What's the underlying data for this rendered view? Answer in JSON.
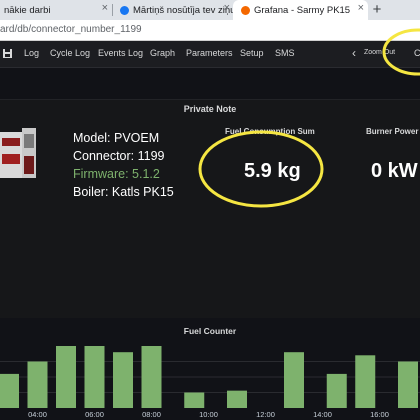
{
  "browser": {
    "tabs": [
      {
        "label": "nākie darbi",
        "favicon_color": "#9e2146"
      },
      {
        "label": "Mārtiņš nosūtīja tev ziņu",
        "favicon_color": "#1877f2"
      },
      {
        "label": "Grafana - Sarmy PK15",
        "favicon_color": "#f46800"
      }
    ],
    "new_tab_symbol": "+",
    "close_symbol": "×",
    "url": "ard/db/connector_number_1199"
  },
  "nav": {
    "save_icon": "save-icon",
    "items": [
      "Log",
      "Cycle Log",
      "Events Log",
      "Graph",
      "Parameters",
      "Setup",
      "SMS"
    ],
    "zoom_out": "Zoom Out",
    "prev_symbol": "‹",
    "clipped_text": "C"
  },
  "private_note": {
    "title": "Private Note"
  },
  "boiler_info": {
    "model": "Model: PVOEM",
    "connector": "Connector: 1199",
    "firmware": "Firmware: 5.1.2",
    "boiler": "Boiler: Katls PK15"
  },
  "stats": {
    "fuel_sum": {
      "title": "Fuel Consumption Sum",
      "value": "5.9 kg"
    },
    "burner_power": {
      "title": "Burner Power",
      "value": "0 kW"
    }
  },
  "annotation_color": "#f5e642",
  "fuel_counter": {
    "title": "Fuel Counter"
  },
  "chart_data": {
    "type": "bar",
    "title": "Fuel Counter",
    "x_tick_labels": [
      "04:00",
      "06:00",
      "08:00",
      "10:00",
      "12:00",
      "14:00",
      "16:00",
      "18:00"
    ],
    "bar_color": "#7eb26d",
    "bars": [
      {
        "time": 2.0,
        "value": 0.5
      },
      {
        "time": 3.0,
        "value": 0.55
      },
      {
        "time": 4.0,
        "value": 0.75
      },
      {
        "time": 5.0,
        "value": 1.0
      },
      {
        "time": 6.0,
        "value": 1.0
      },
      {
        "time": 7.0,
        "value": 0.9
      },
      {
        "time": 8.0,
        "value": 1.0
      },
      {
        "time": 9.5,
        "value": 0.25
      },
      {
        "time": 11.0,
        "value": 0.28
      },
      {
        "time": 13.0,
        "value": 0.9
      },
      {
        "time": 14.5,
        "value": 0.55
      },
      {
        "time": 15.5,
        "value": 0.85
      },
      {
        "time": 17.0,
        "value": 0.75
      },
      {
        "time": 18.0,
        "value": 0.55
      }
    ]
  }
}
